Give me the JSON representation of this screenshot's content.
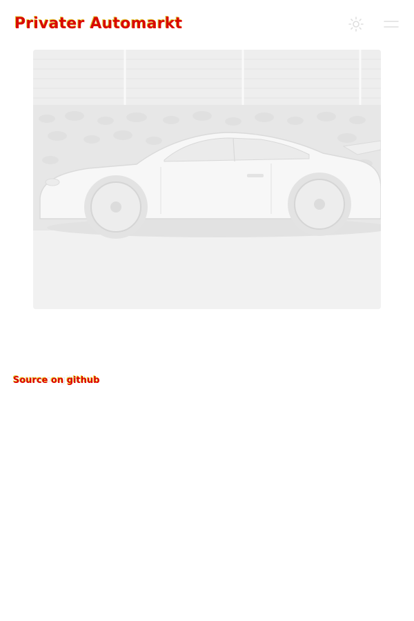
{
  "header": {
    "brand": "Privater Automarkt",
    "theme_toggle_icon": "sun-icon",
    "menu_icon": "menu-icon"
  },
  "hero": {
    "image_subject": "car-photo"
  },
  "footer": {
    "source_label": "Source on",
    "source_link": "github",
    "source_full": "Source on github"
  },
  "colors": {
    "background": "#ffffff",
    "text_faded": "#e9e9e9",
    "glitch_red": "#e10000",
    "glitch_yellow": "#f2d000",
    "image_bg": "#f4f4f4"
  }
}
